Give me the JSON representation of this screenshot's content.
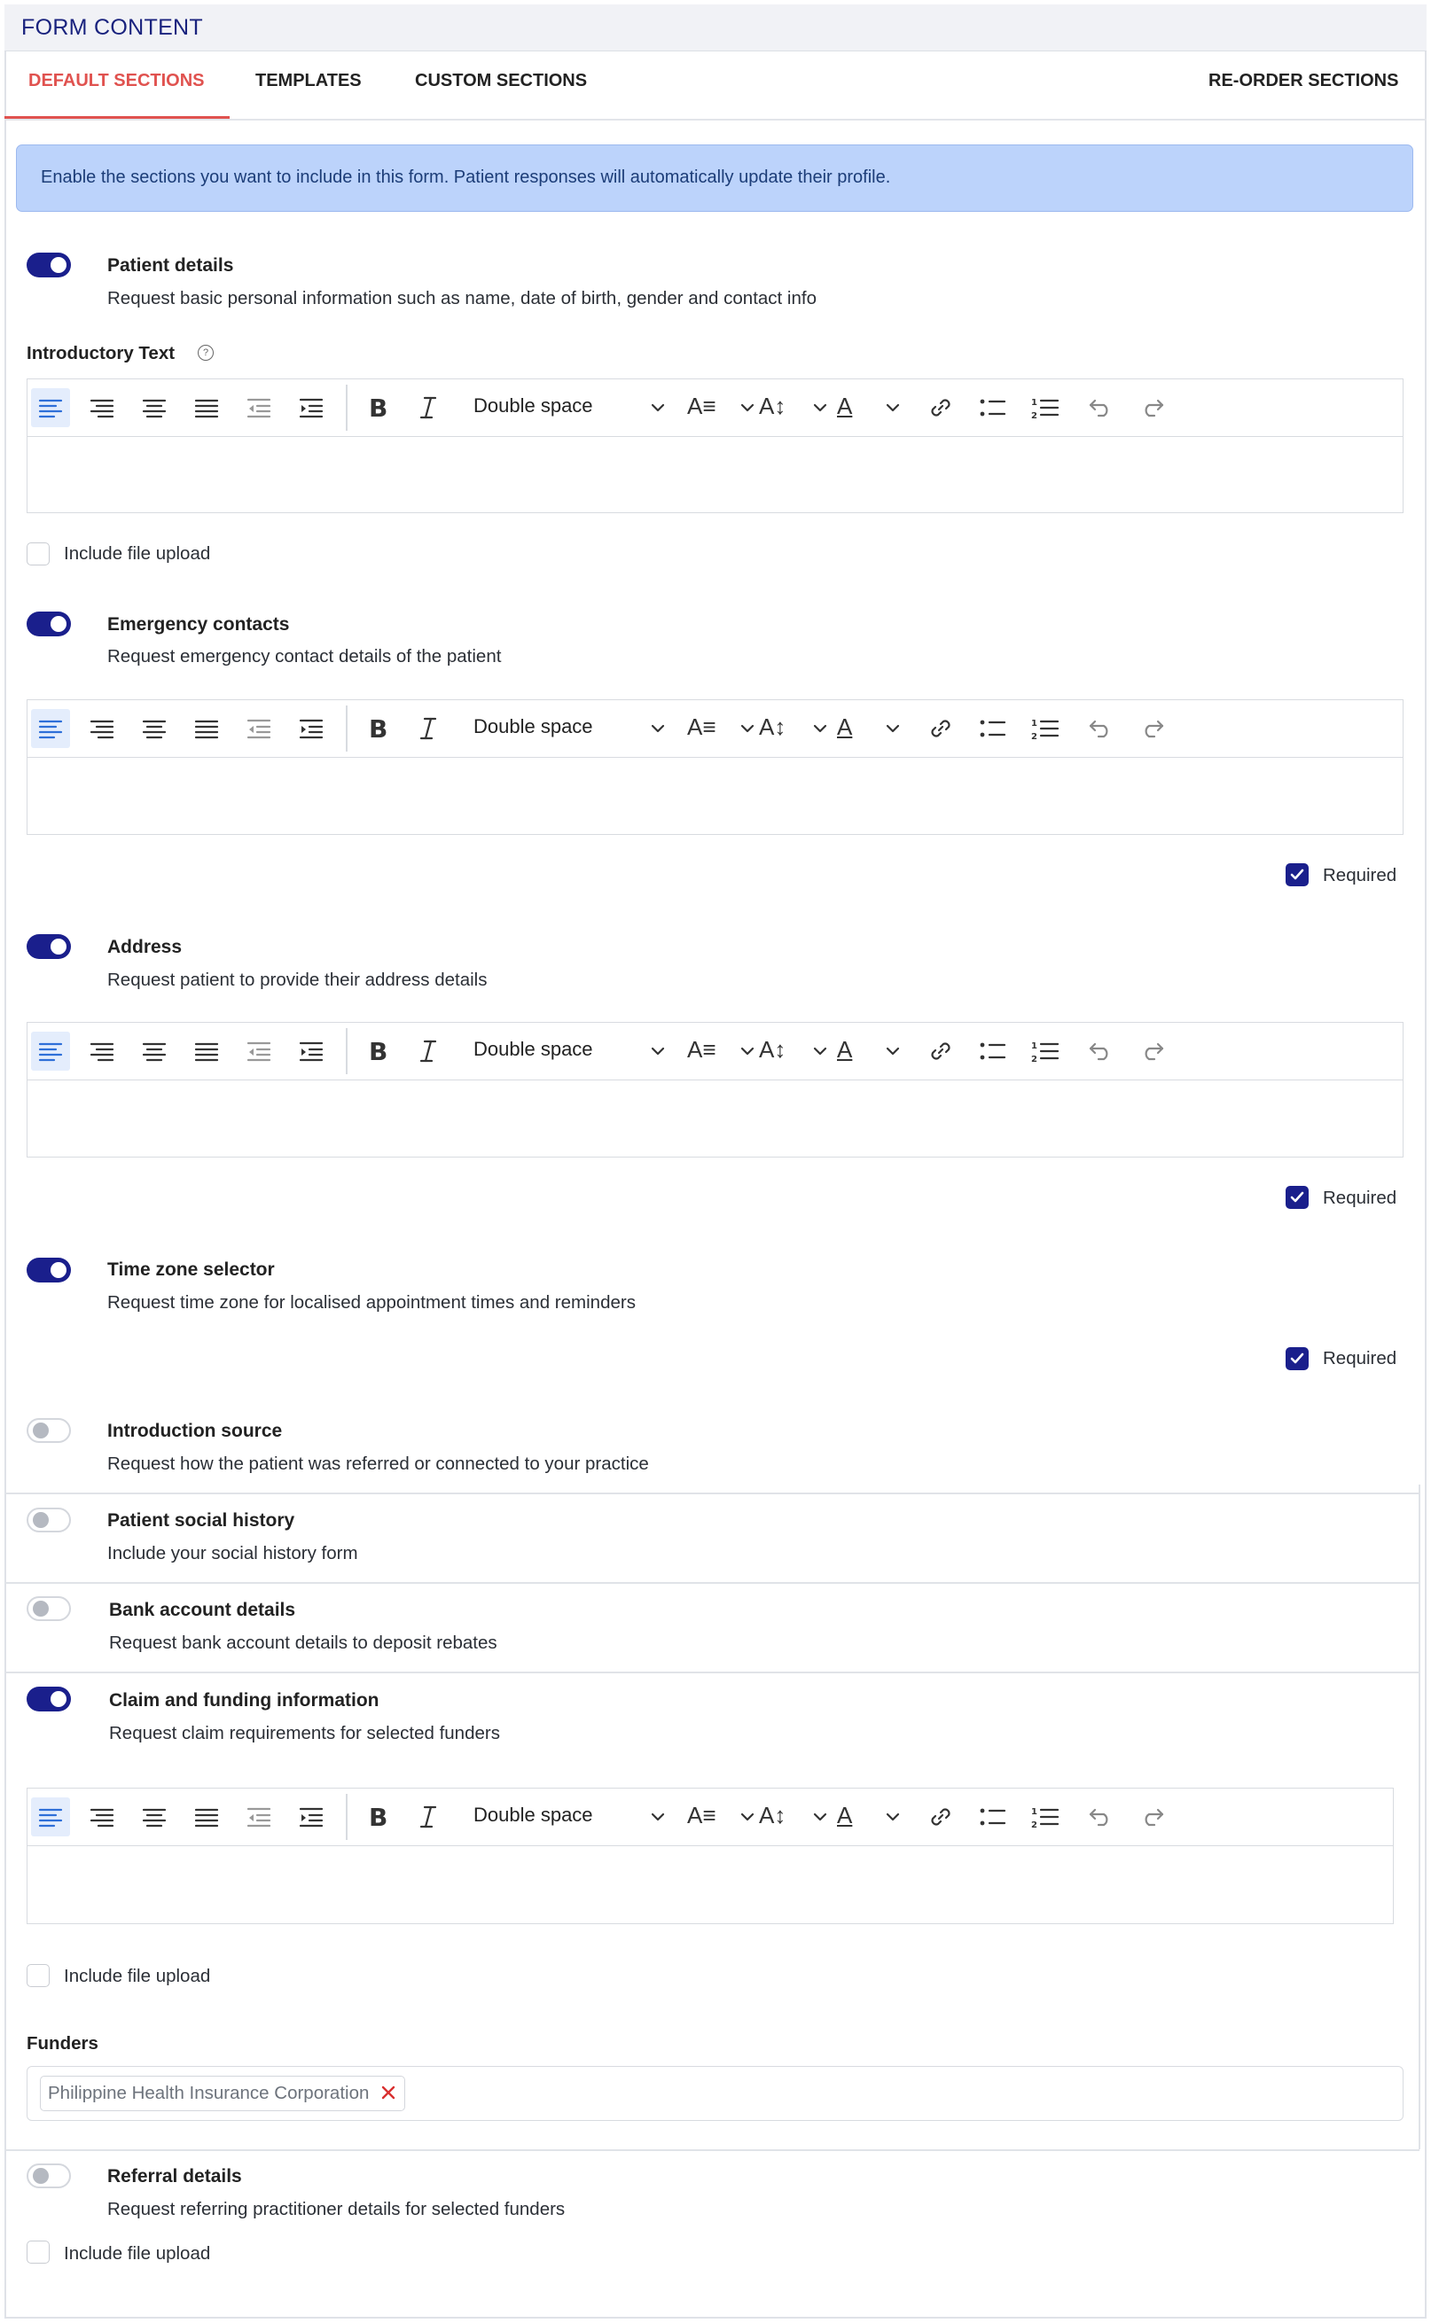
{
  "header": {
    "title": "FORM CONTENT"
  },
  "tabs": [
    {
      "label": "DEFAULT SECTIONS",
      "active": true
    },
    {
      "label": "TEMPLATES",
      "active": false
    },
    {
      "label": "CUSTOM SECTIONS",
      "active": false
    },
    {
      "label": "RE-ORDER SECTIONS",
      "active": false
    }
  ],
  "info_banner": {
    "text": "Enable the sections you want to include in this form. Patient responses will automatically update their profile."
  },
  "editor_toolbar": {
    "line_spacing": "Double space"
  },
  "colors": {
    "accent": "#1a1f8c",
    "tab_active": "#e0524f",
    "info_bg": "#bcd3fb",
    "remove": "#d93030"
  },
  "sections": {
    "patient_details": {
      "title": "Patient details",
      "description": "Request basic personal information such as name, date of birth, gender and contact info",
      "enabled": true
    },
    "intro_text": {
      "label": "Introductory Text"
    },
    "file_upload_1": {
      "label": "Include file upload",
      "checked": false
    },
    "emergency": {
      "title": "Emergency contacts",
      "description": "Request emergency contact details of the patient",
      "enabled": true
    },
    "required_1": {
      "label": "Required",
      "checked": true
    },
    "address": {
      "title": "Address",
      "description": "Request patient to provide their address details",
      "enabled": true
    },
    "required_2": {
      "label": "Required",
      "checked": true
    },
    "timezone": {
      "title": "Time zone selector",
      "description": "Request time zone for localised appointment times and reminders",
      "enabled": true
    },
    "required_3": {
      "label": "Required",
      "checked": true
    },
    "intro_source": {
      "title": "Introduction source",
      "description": "Request how the patient was referred or connected to your practice",
      "enabled": false
    },
    "social_history": {
      "title": "Patient social history",
      "description": "Include your social history form",
      "enabled": false
    },
    "bank": {
      "title": "Bank account details",
      "description": "Request bank account details to deposit rebates",
      "enabled": false
    },
    "claim": {
      "title": "Claim and funding information",
      "description": "Request claim requirements for selected funders",
      "enabled": true
    },
    "file_upload_2": {
      "label": "Include file upload",
      "checked": false
    },
    "funders": {
      "label": "Funders",
      "selected": [
        "Philippine Health Insurance Corporation"
      ]
    },
    "referral": {
      "title": "Referral details",
      "description": "Request referring practitioner details for selected funders",
      "enabled": false
    },
    "file_upload_3": {
      "label": "Include file upload",
      "checked": false
    }
  }
}
